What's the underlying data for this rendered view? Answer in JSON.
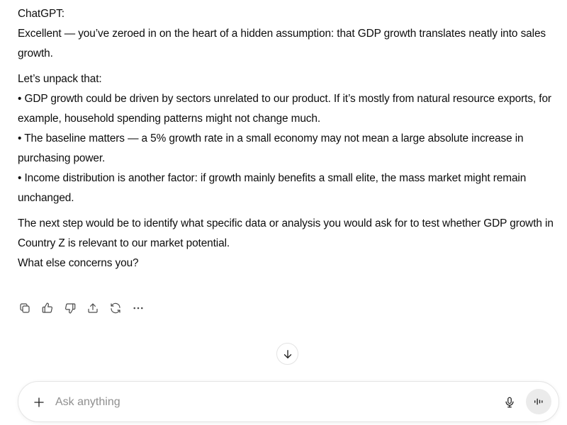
{
  "message": {
    "speaker": "ChatGPT:",
    "intro": "Excellent — you’ve zeroed in on the heart of a hidden assumption: that GDP growth translates neatly into sales growth.",
    "lead_in": "Let’s unpack that:",
    "bullets": [
      "GDP growth could be driven by sectors unrelated to our product. If it’s mostly from natural resource exports, for example, household spending patterns might not change much.",
      "The baseline matters — a 5% growth rate in a small economy may not mean a large absolute increase in purchasing power.",
      "Income distribution is another factor: if growth mainly benefits a small elite, the mass market might remain unchanged."
    ],
    "next_step": "The next step would be to identify what specific data or analysis you would ask for to test whether GDP growth in Country Z is relevant to our market potential.",
    "question": "What else concerns you?"
  },
  "actions": {
    "icons": [
      "copy-icon",
      "thumbs-up-icon",
      "thumbs-down-icon",
      "share-icon",
      "regenerate-icon",
      "more-icon"
    ]
  },
  "composer": {
    "placeholder": "Ask anything",
    "value": ""
  },
  "colors": {
    "text": "#0d0d0d",
    "placeholder": "#8f8f8f",
    "icon": "#4a4a4a",
    "voice_button_bg": "#ebebeb",
    "composer_border": "#e5e5e5"
  }
}
